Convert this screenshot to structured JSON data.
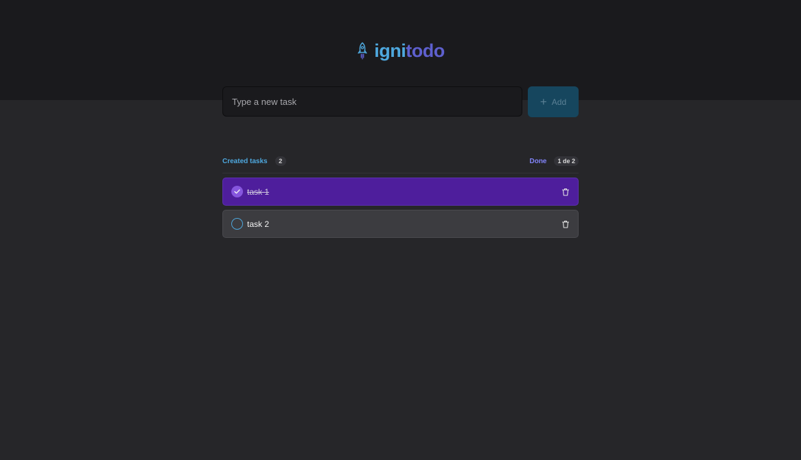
{
  "header": {
    "logo_part1": "igni",
    "logo_part2": "todo",
    "logo_icon": "rocket-icon"
  },
  "new_task": {
    "placeholder": "Type a new task",
    "value": "",
    "add_label": "Add",
    "add_icon": "plus-icon"
  },
  "summary": {
    "created_label": "Created tasks",
    "created_count": "2",
    "done_label": "Done",
    "done_count": "1 de 2"
  },
  "tasks": [
    {
      "text": "task 1",
      "done": true
    },
    {
      "text": "task 2",
      "done": false
    }
  ],
  "colors": {
    "brand_blue": "#4ea8de",
    "brand_purple": "#5e60ce",
    "done_accent": "#8284fa",
    "done_task_bg": "#4e1e9c"
  }
}
